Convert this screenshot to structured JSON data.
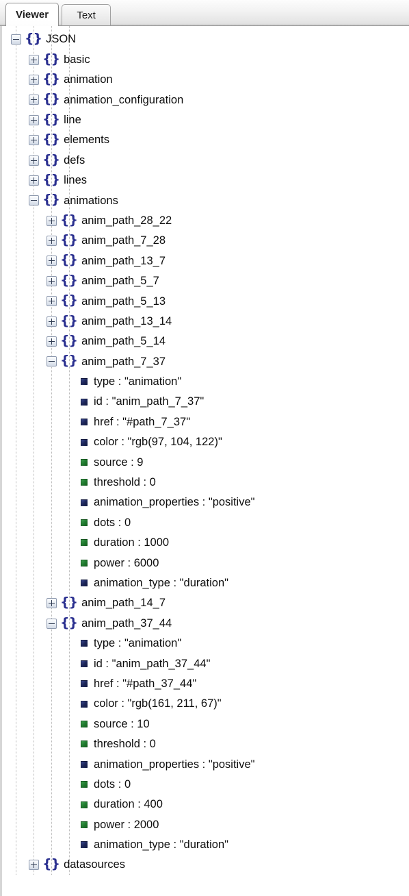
{
  "tabs": [
    {
      "label": "Viewer",
      "active": true
    },
    {
      "label": "Text",
      "active": false
    }
  ],
  "colors": {
    "string_marker": "#1c2558",
    "number_marker": "#1f7a2e",
    "braces": "#2a2f8f",
    "guide_line": "#b9b9b9",
    "tab_active_bg": "#ffffff",
    "tabbar_bg": "#ededed"
  },
  "tree": {
    "root_label": "JSON",
    "nodes": [
      {
        "depth": 0,
        "kind": "object",
        "state": "expanded",
        "label": "JSON"
      },
      {
        "depth": 1,
        "kind": "object",
        "state": "collapsed",
        "label": "basic"
      },
      {
        "depth": 1,
        "kind": "object",
        "state": "collapsed",
        "label": "animation"
      },
      {
        "depth": 1,
        "kind": "object",
        "state": "collapsed",
        "label": "animation_configuration"
      },
      {
        "depth": 1,
        "kind": "object",
        "state": "collapsed",
        "label": "line"
      },
      {
        "depth": 1,
        "kind": "object",
        "state": "collapsed",
        "label": "elements"
      },
      {
        "depth": 1,
        "kind": "object",
        "state": "collapsed",
        "label": "defs"
      },
      {
        "depth": 1,
        "kind": "object",
        "state": "collapsed",
        "label": "lines"
      },
      {
        "depth": 1,
        "kind": "object",
        "state": "expanded",
        "label": "animations"
      },
      {
        "depth": 2,
        "kind": "object",
        "state": "collapsed",
        "label": "anim_path_28_22"
      },
      {
        "depth": 2,
        "kind": "object",
        "state": "collapsed",
        "label": "anim_path_7_28"
      },
      {
        "depth": 2,
        "kind": "object",
        "state": "collapsed",
        "label": "anim_path_13_7"
      },
      {
        "depth": 2,
        "kind": "object",
        "state": "collapsed",
        "label": "anim_path_5_7"
      },
      {
        "depth": 2,
        "kind": "object",
        "state": "collapsed",
        "label": "anim_path_5_13"
      },
      {
        "depth": 2,
        "kind": "object",
        "state": "collapsed",
        "label": "anim_path_13_14"
      },
      {
        "depth": 2,
        "kind": "object",
        "state": "collapsed",
        "label": "anim_path_5_14"
      },
      {
        "depth": 2,
        "kind": "object",
        "state": "expanded",
        "label": "anim_path_7_37"
      },
      {
        "depth": 3,
        "kind": "string",
        "label": "type : \"animation\""
      },
      {
        "depth": 3,
        "kind": "string",
        "label": "id : \"anim_path_7_37\""
      },
      {
        "depth": 3,
        "kind": "string",
        "label": "href : \"#path_7_37\""
      },
      {
        "depth": 3,
        "kind": "string",
        "label": "color : \"rgb(97, 104, 122)\""
      },
      {
        "depth": 3,
        "kind": "number",
        "label": "source : 9"
      },
      {
        "depth": 3,
        "kind": "number",
        "label": "threshold : 0"
      },
      {
        "depth": 3,
        "kind": "string",
        "label": "animation_properties : \"positive\""
      },
      {
        "depth": 3,
        "kind": "number",
        "label": "dots : 0"
      },
      {
        "depth": 3,
        "kind": "number",
        "label": "duration : 1000"
      },
      {
        "depth": 3,
        "kind": "number",
        "label": "power : 6000"
      },
      {
        "depth": 3,
        "kind": "string",
        "label": "animation_type : \"duration\""
      },
      {
        "depth": 2,
        "kind": "object",
        "state": "collapsed",
        "label": "anim_path_14_7"
      },
      {
        "depth": 2,
        "kind": "object",
        "state": "expanded",
        "label": "anim_path_37_44"
      },
      {
        "depth": 3,
        "kind": "string",
        "label": "type : \"animation\""
      },
      {
        "depth": 3,
        "kind": "string",
        "label": "id : \"anim_path_37_44\""
      },
      {
        "depth": 3,
        "kind": "string",
        "label": "href : \"#path_37_44\""
      },
      {
        "depth": 3,
        "kind": "string",
        "label": "color : \"rgb(161, 211, 67)\""
      },
      {
        "depth": 3,
        "kind": "number",
        "label": "source : 10"
      },
      {
        "depth": 3,
        "kind": "number",
        "label": "threshold : 0"
      },
      {
        "depth": 3,
        "kind": "string",
        "label": "animation_properties : \"positive\""
      },
      {
        "depth": 3,
        "kind": "number",
        "label": "dots : 0"
      },
      {
        "depth": 3,
        "kind": "number",
        "label": "duration : 400"
      },
      {
        "depth": 3,
        "kind": "number",
        "label": "power : 2000"
      },
      {
        "depth": 3,
        "kind": "string",
        "label": "animation_type : \"duration\""
      },
      {
        "depth": 1,
        "kind": "object",
        "state": "collapsed",
        "label": "datasources"
      }
    ]
  }
}
